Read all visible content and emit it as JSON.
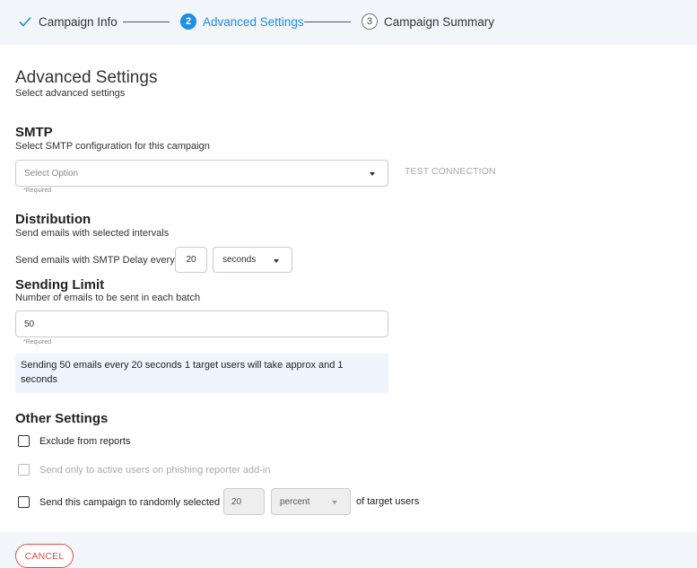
{
  "stepper": {
    "steps": [
      {
        "label": "Campaign Info",
        "state": "done"
      },
      {
        "number": "2",
        "label": "Advanced Settings",
        "state": "active"
      },
      {
        "number": "3",
        "label": "Campaign Summary",
        "state": "upcoming"
      }
    ],
    "accent": "#1e8ee6"
  },
  "page": {
    "title": "Advanced Settings",
    "subtitle": "Select advanced settings"
  },
  "smtp": {
    "title": "SMTP",
    "subtitle": "Select SMTP configuration for this campaign",
    "select_placeholder": "Select Option",
    "required": "*Required",
    "test_connection": "TEST CONNECTION"
  },
  "distribution": {
    "title": "Distribution",
    "subtitle": "Send emails with selected intervals",
    "delay_label": "Send emails with SMTP Delay every",
    "delay_value": "20",
    "unit": "seconds"
  },
  "sending_limit": {
    "title": "Sending Limit",
    "subtitle": "Number of emails to be sent in each batch",
    "value": "50",
    "required": "*Required",
    "info_line1": "Sending 50 emails every 20 seconds 1 target users will take approx and 1",
    "info_line2": "seconds"
  },
  "other": {
    "title": "Other Settings",
    "exclude_label": "Exclude from reports",
    "active_users_label": "Send only to active users on phishing reporter add-in",
    "random_label": "Send this campaign to randomly selected",
    "random_value": "20",
    "random_unit": "percent",
    "random_suffix": "of target users"
  },
  "footer": {
    "cancel_label": "CANCEL",
    "cancel_color": "#e84c4c"
  }
}
